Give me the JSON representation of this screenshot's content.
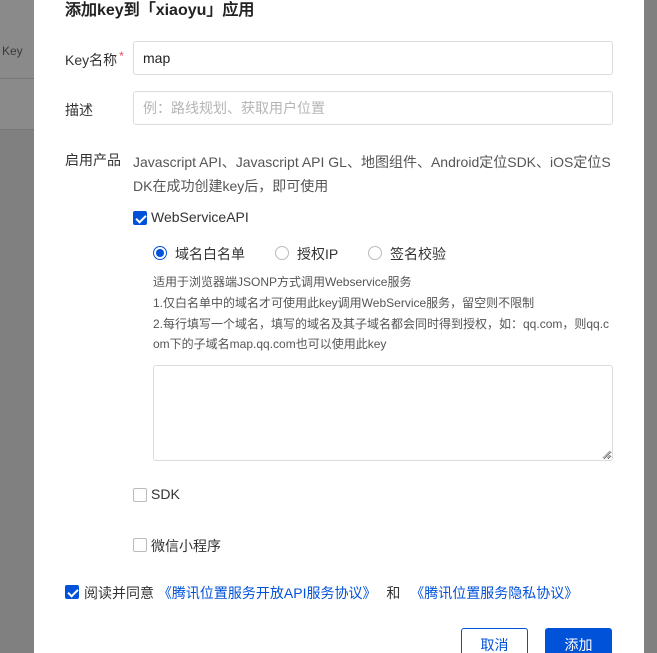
{
  "background": {
    "key_label": "Key"
  },
  "modal": {
    "title": "添加key到「xiaoyu」应用",
    "key_name": {
      "label": "Key名称",
      "required_mark": "*",
      "value": "map"
    },
    "description": {
      "label": "描述",
      "placeholder": "例：路线规划、获取用户位置",
      "value": ""
    },
    "products": {
      "label": "启用产品",
      "text": "Javascript API、Javascript API GL、地图组件、Android定位SDK、iOS定位SDK在成功创建key后，即可使用"
    },
    "webservice": {
      "label": "WebServiceAPI",
      "checked": true,
      "radios": [
        {
          "label": "域名白名单",
          "checked": true
        },
        {
          "label": "授权IP",
          "checked": false
        },
        {
          "label": "签名校验",
          "checked": false
        }
      ],
      "help": [
        "适用于浏览器端JSONP方式调用Webservice服务",
        "1.仅白名单中的域名才可使用此key调用WebService服务，留空则不限制",
        "2.每行填写一个域名，填写的域名及其子域名都会同时得到授权，如：qq.com，则qq.com下的子域名map.qq.com也可以使用此key"
      ],
      "domains_value": ""
    },
    "sdk": {
      "label": "SDK",
      "checked": false
    },
    "mini_program": {
      "label": "微信小程序",
      "checked": false
    },
    "agreement": {
      "checked": true,
      "prefix": "阅读并同意",
      "link1": "《腾讯位置服务开放API服务协议》",
      "and": "和",
      "link2": "《腾讯位置服务隐私协议》"
    },
    "buttons": {
      "cancel": "取消",
      "ok": "添加"
    }
  },
  "colors": {
    "primary": "#0052d9",
    "required": "#e34d59",
    "overlay": "#7f7f7f"
  }
}
